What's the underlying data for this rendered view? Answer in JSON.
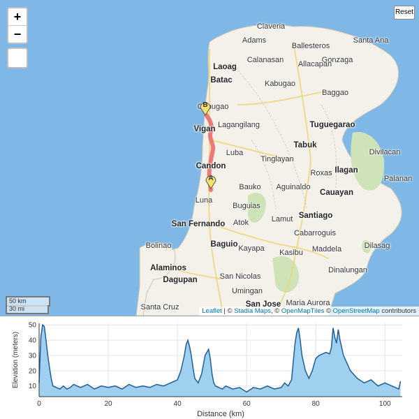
{
  "map": {
    "controls": {
      "zoom_in": "+",
      "zoom_out": "−",
      "reset": "Reset"
    },
    "scale": {
      "km": "50 km",
      "mi": "30 mi"
    },
    "attribution": {
      "leaflet": "Leaflet",
      "sep1": " | © ",
      "stadia": "Stadia Maps",
      "sep2": ", © ",
      "omt": "OpenMapTiles",
      "sep3": " © ",
      "osm": "OpenStreetMap",
      "tail": " contributors"
    },
    "markers": {
      "start": "A",
      "end": "B"
    },
    "places": [
      {
        "name": "Claveria",
        "big": false
      },
      {
        "name": "Adams",
        "big": false
      },
      {
        "name": "Ballesteros",
        "big": false
      },
      {
        "name": "Santa Ana",
        "big": false
      },
      {
        "name": "Calanasan",
        "big": false
      },
      {
        "name": "Gonzaga",
        "big": false
      },
      {
        "name": "Laoag",
        "big": true
      },
      {
        "name": "Allacapan",
        "big": false
      },
      {
        "name": "Batac",
        "big": true
      },
      {
        "name": "Kabugao",
        "big": false
      },
      {
        "name": "Baggao",
        "big": false
      },
      {
        "name": "Cabugao",
        "big": false
      },
      {
        "name": "Lagangilang",
        "big": false
      },
      {
        "name": "Tuguegarao",
        "big": true
      },
      {
        "name": "Vigan",
        "big": true
      },
      {
        "name": "Tabuk",
        "big": true
      },
      {
        "name": "Divilacan",
        "big": false
      },
      {
        "name": "Luba",
        "big": false
      },
      {
        "name": "Tinglayan",
        "big": false
      },
      {
        "name": "Candon",
        "big": true
      },
      {
        "name": "Roxas",
        "big": false
      },
      {
        "name": "Ilagan",
        "big": true
      },
      {
        "name": "Palanan",
        "big": false
      },
      {
        "name": "Bauko",
        "big": false
      },
      {
        "name": "Aguinaldo",
        "big": false
      },
      {
        "name": "Cauayan",
        "big": true
      },
      {
        "name": "Luna",
        "big": false
      },
      {
        "name": "Buguias",
        "big": false
      },
      {
        "name": "Santiago",
        "big": true
      },
      {
        "name": "Lamut",
        "big": false
      },
      {
        "name": "San Fernando",
        "big": true
      },
      {
        "name": "Atok",
        "big": false
      },
      {
        "name": "Cabarroguis",
        "big": false
      },
      {
        "name": "Baguio",
        "big": true
      },
      {
        "name": "Bolinao",
        "big": false
      },
      {
        "name": "Kayapa",
        "big": false
      },
      {
        "name": "Kasibu",
        "big": false
      },
      {
        "name": "Maddela",
        "big": false
      },
      {
        "name": "Dilasag",
        "big": false
      },
      {
        "name": "Alaminos",
        "big": true
      },
      {
        "name": "Dinalungan",
        "big": false
      },
      {
        "name": "Dagupan",
        "big": true
      },
      {
        "name": "San Nicolas",
        "big": false
      },
      {
        "name": "Umingan",
        "big": false
      },
      {
        "name": "Santa Cruz",
        "big": false
      },
      {
        "name": "San Jose",
        "big": true
      },
      {
        "name": "Maria Aurora",
        "big": false
      }
    ]
  },
  "chart_data": {
    "type": "area",
    "xlabel": "Distance (km)",
    "ylabel": "Elevation (meters)",
    "xlim": [
      0,
      105
    ],
    "ylim": [
      3,
      51
    ],
    "xticks": [
      0,
      20,
      40,
      60,
      80,
      100
    ],
    "yticks": [
      10,
      20,
      30,
      40,
      50
    ],
    "grid": true,
    "x": [
      0,
      0.5,
      1,
      1.5,
      2,
      2.5,
      3,
      3.5,
      4,
      5,
      6,
      7,
      8,
      9,
      10,
      12,
      14,
      16,
      18,
      20,
      22,
      24,
      26,
      28,
      30,
      32,
      34,
      36,
      38,
      40,
      41,
      42,
      42.5,
      43,
      43.5,
      44,
      44.5,
      45,
      46,
      47,
      48,
      49,
      49.5,
      50,
      50.5,
      51,
      52,
      53,
      54,
      56,
      58,
      60,
      62,
      64,
      66,
      68,
      70,
      71,
      72,
      73,
      74,
      74.5,
      75,
      75.5,
      76,
      77,
      78,
      79,
      80,
      81,
      82,
      83,
      84,
      84.5,
      85,
      85.5,
      86,
      86.5,
      87,
      88,
      89,
      90,
      92,
      94,
      96,
      98,
      100,
      102,
      104,
      104.5
    ],
    "y": [
      12,
      42,
      50,
      49,
      40,
      30,
      22,
      15,
      10,
      9,
      8,
      10,
      8,
      9,
      11,
      9,
      11,
      8,
      10,
      9,
      10,
      8,
      11,
      9,
      10,
      9,
      11,
      10,
      12,
      14,
      20,
      30,
      37,
      40,
      36,
      30,
      22,
      15,
      12,
      18,
      30,
      34,
      28,
      18,
      12,
      10,
      9,
      8,
      10,
      8,
      9,
      6,
      9,
      8,
      10,
      8,
      9,
      12,
      10,
      14,
      38,
      45,
      48,
      40,
      30,
      20,
      15,
      20,
      28,
      30,
      31,
      32,
      31,
      35,
      48,
      42,
      38,
      47,
      40,
      30,
      25,
      20,
      15,
      12,
      14,
      10,
      12,
      10,
      8,
      13
    ]
  }
}
